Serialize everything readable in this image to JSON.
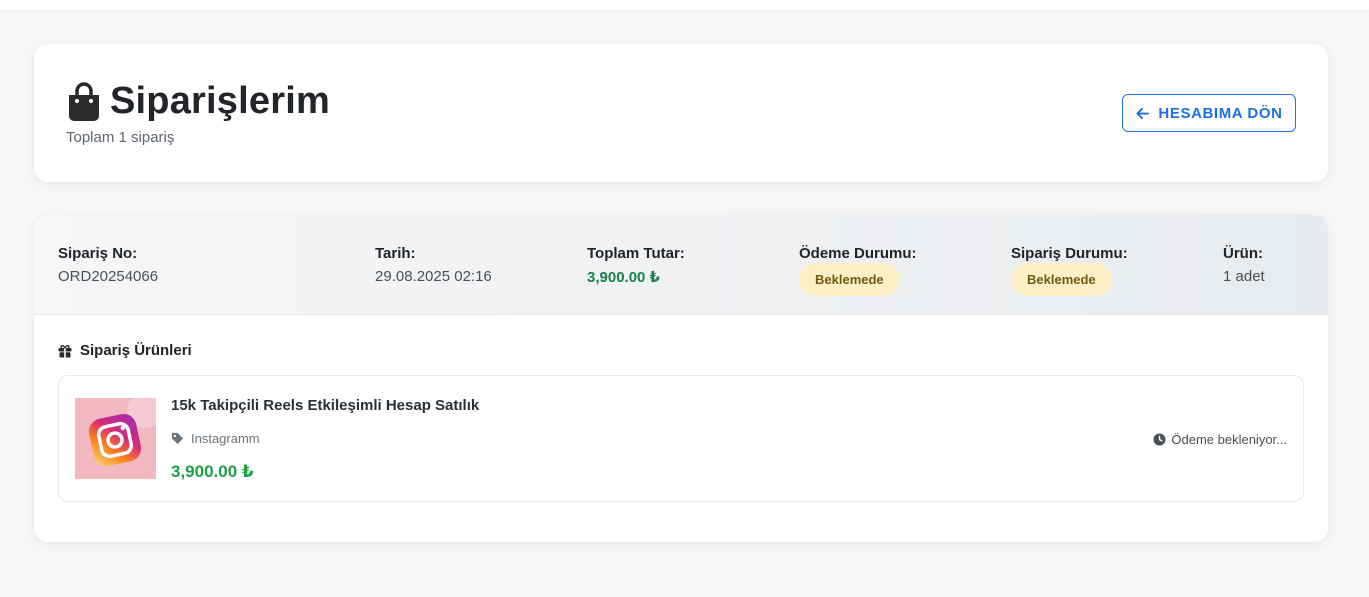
{
  "header": {
    "title": "Siparişlerim",
    "subtitle": "Toplam 1 sipariş",
    "back_button_label": "HESABIMA DÖN"
  },
  "order": {
    "order_no_label": "Sipariş No:",
    "order_no": "ORD20254066",
    "date_label": "Tarih:",
    "date": "29.08.2025 02:16",
    "total_label": "Toplam Tutar:",
    "total": "3,900.00 ₺",
    "payment_status_label": "Ödeme Durumu:",
    "payment_status": "Beklemede",
    "order_status_label": "Sipariş Durumu:",
    "order_status": "Beklemede",
    "product_count_label": "Ürün:",
    "product_count": "1 adet",
    "items_section_title": "Sipariş Ürünleri",
    "items": [
      {
        "title": "15k Takipçili Reels Etkileşimli Hesap Satılık",
        "category": "Instagramm",
        "price": "3,900.00 ₺",
        "status": "Ödeme bekleniyor...",
        "image_icon": "instagram-logo-icon"
      }
    ]
  },
  "colors": {
    "accent": "#1f6fe0",
    "price_green": "#1e9e45",
    "badge_bg": "#fdf0c6",
    "badge_text": "#6f5a10"
  }
}
